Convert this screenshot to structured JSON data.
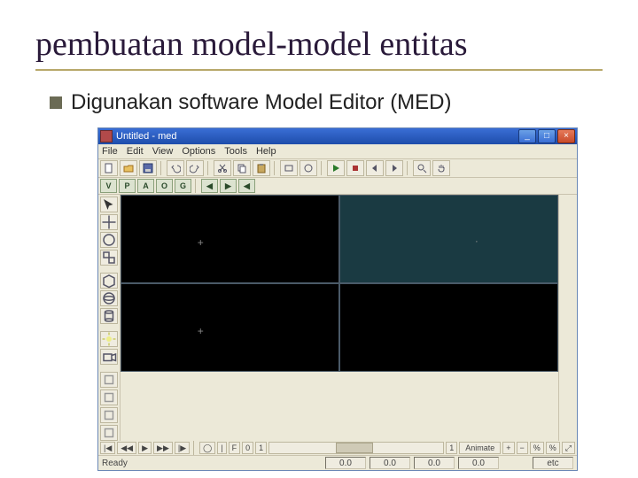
{
  "slide": {
    "title": "pembuatan model-model entitas",
    "bullet": "Digunakan software Model Editor (MED)"
  },
  "app": {
    "title": "Untitled - med",
    "menu": [
      "File",
      "Edit",
      "View",
      "Options",
      "Tools",
      "Help"
    ],
    "toolbar_icons": [
      "new",
      "open",
      "save",
      "",
      "undo",
      "redo",
      "",
      "cut",
      "copy",
      "paste",
      "",
      "rect",
      "circle",
      "",
      "play",
      "stop",
      "prev",
      "next",
      "",
      "zoom",
      "hand"
    ],
    "mode_buttons": [
      "V",
      "P",
      "A",
      "O",
      "G",
      "",
      "◀",
      "▶",
      "◀"
    ],
    "left_palette": [
      "sel",
      "mv",
      "rot",
      "scl",
      "",
      "box",
      "sph",
      "cyl",
      "",
      "lt",
      "cam",
      "",
      "fx",
      "a",
      "b",
      "c"
    ],
    "bottom_bar": {
      "left_buttons": [
        "|◀",
        "◀◀",
        "▶",
        "▶▶",
        "|▶",
        "",
        "◯",
        "|",
        "F",
        "0",
        "1"
      ],
      "frame_label": "1",
      "animate_label": "Animate",
      "right_buttons": [
        "+",
        "−",
        "%",
        "%",
        "⤢"
      ]
    },
    "status": {
      "label": "Ready",
      "coords": [
        "0.0",
        "0.0",
        "0.0",
        "0.0"
      ],
      "right": "etc"
    }
  }
}
